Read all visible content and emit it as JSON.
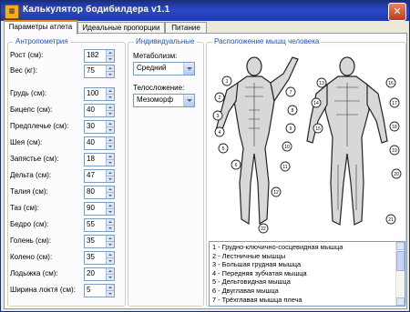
{
  "window": {
    "title": "Калькулятор бодибилдера v1.1",
    "close": "✕",
    "icon": "calculator-icon"
  },
  "tabs": [
    {
      "label": "Параметры атлета"
    },
    {
      "label": "Идеальные пропорции"
    },
    {
      "label": "Питание"
    }
  ],
  "anthropometry": {
    "title": "Антропометрия",
    "fields": [
      {
        "label": "Рост (см):",
        "value": "182"
      },
      {
        "label": "Вес (кг):",
        "value": "75"
      },
      {
        "label": "Грудь (см):",
        "value": "100"
      },
      {
        "label": "Бицепс (см):",
        "value": "40"
      },
      {
        "label": "Предплечье (см):",
        "value": "30"
      },
      {
        "label": "Шея (см):",
        "value": "40"
      },
      {
        "label": "Запястье (см):",
        "value": "18"
      },
      {
        "label": "Дельта (см):",
        "value": "47"
      },
      {
        "label": "Талия (см):",
        "value": "80"
      },
      {
        "label": "Таз (см):",
        "value": "90"
      },
      {
        "label": "Бедро (см):",
        "value": "55"
      },
      {
        "label": "Голень (см):",
        "value": "35"
      },
      {
        "label": "Колено (см):",
        "value": "35"
      },
      {
        "label": "Лодыжка (см):",
        "value": "20"
      },
      {
        "label": "Ширина локтя (см):",
        "value": "5"
      }
    ]
  },
  "individual": {
    "title": "Индивидуальные",
    "metabolism_label": "Метаболизм:",
    "metabolism_value": "Средний",
    "bodytype_label": "Телосложение:",
    "bodytype_value": "Мезоморф"
  },
  "muscles": {
    "title": "Расположение мышц человека",
    "figure_numbers": [
      "1",
      "2",
      "3",
      "4",
      "5",
      "6",
      "7",
      "8",
      "9",
      "10",
      "11",
      "12",
      "13",
      "14",
      "15",
      "16",
      "17",
      "18",
      "19",
      "20",
      "21",
      "22"
    ],
    "list": [
      "1 - Грудно-ключично-сосцевидная мышца",
      "2 - Лестничные мышцы",
      "3 - Большая грудная мышца",
      "4 - Передняя зубчатая мышца",
      "5 - Дельтовидная мышца",
      "6 - Двуглавая мышца",
      "7 - Трёхглавая мышца плеча"
    ]
  }
}
